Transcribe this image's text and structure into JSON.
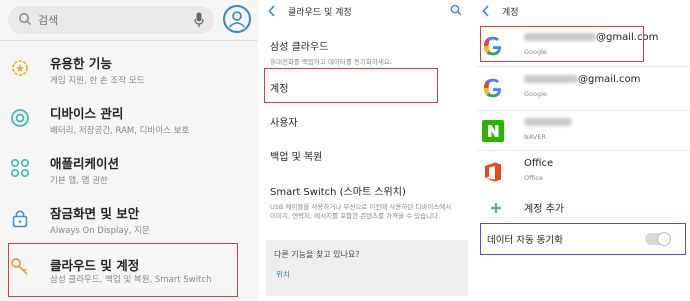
{
  "panel1": {
    "search": {
      "placeholder": "검색"
    },
    "menu": [
      {
        "title": "유용한 기능",
        "subtitle": "게임 지원, 한 손 조작 모드",
        "icon": "star-gear-icon"
      },
      {
        "title": "디바이스 관리",
        "subtitle": "배터리, 저장공간, RAM, 디바이스 보호",
        "icon": "device-care-icon"
      },
      {
        "title": "애플리케이션",
        "subtitle": "기본 앱, 앱 권한",
        "icon": "apps-grid-icon"
      },
      {
        "title": "잠금화면 및 보안",
        "subtitle": "Always On Display, 지문",
        "icon": "lock-icon"
      },
      {
        "title": "클라우드 및 계정",
        "subtitle": "삼성 클라우드, 백업 및 복원, Smart Switch",
        "icon": "key-icon"
      }
    ]
  },
  "panel2": {
    "title": "클라우드 및 계정",
    "items": [
      {
        "title": "삼성 클라우드",
        "subtitle": "휴대전화를 백업하고 데이터를 동기화하세요."
      },
      {
        "title": "계정",
        "subtitle": ""
      },
      {
        "title": "사용자",
        "subtitle": ""
      },
      {
        "title": "백업 및 복원",
        "subtitle": ""
      },
      {
        "title": "Smart Switch (스마트 스위치)",
        "subtitle": "USB 케이블을 사용하거나 무선으로 이전에 사용하던 디바이스에서 이미지, 연락처, 메시지를 포함한 콘텐츠를 가져올 수 있습니다."
      }
    ],
    "help": {
      "question": "다른 기능을 찾고 있나요?",
      "link": "위치"
    }
  },
  "panel3": {
    "title": "계정",
    "accounts": [
      {
        "name_suffix": "@gmail.com",
        "type": "Google",
        "icon": "google-icon"
      },
      {
        "name_suffix": "@gmail.com",
        "type": "Google",
        "icon": "google-icon"
      },
      {
        "name_suffix": "",
        "type": "NAVER",
        "icon": "naver-icon"
      },
      {
        "name_suffix": "Office",
        "type": "Office",
        "icon": "office-icon"
      }
    ],
    "add_account": "계정 추가",
    "auto_sync": {
      "label": "데이터 자동 동기화",
      "enabled": false
    }
  }
}
